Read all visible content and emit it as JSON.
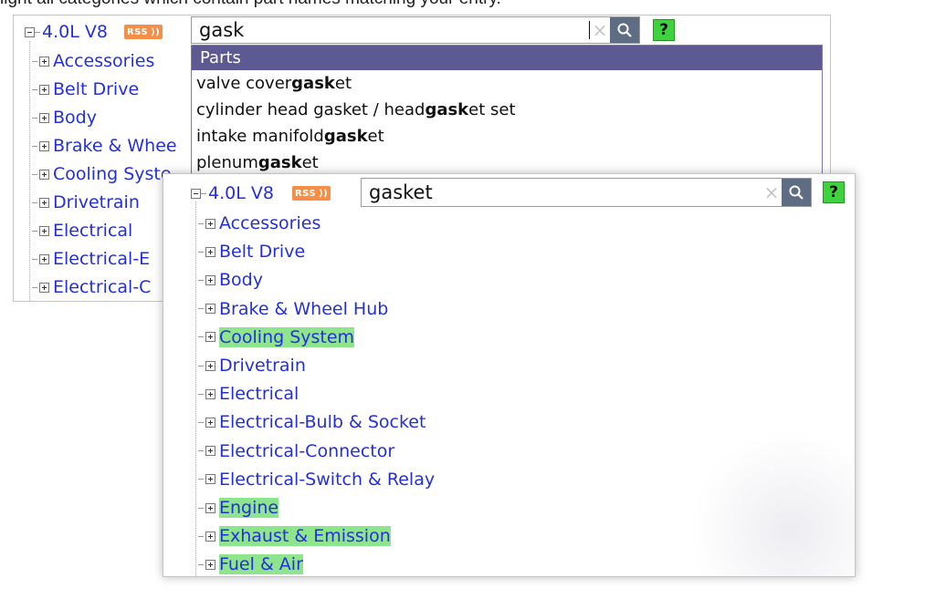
{
  "caption": "light all categories which contain part names matching your entry.",
  "brand_colors": {
    "link": "#2330d8",
    "highlight": "#8ee58e",
    "dropdown_header": "#5d5992",
    "search_button": "#5e6c84",
    "help_button": "#3ed23e",
    "rss": "#f58e46"
  },
  "panel_back": {
    "root_label": "4.0L V8",
    "rss_label": "RSS",
    "search_value": "gask",
    "clear_glyph": "×",
    "help_label": "?",
    "categories": [
      "Accessories",
      "Belt Drive",
      "Body",
      "Brake & Whee",
      "Cooling Syste",
      "Drivetrain",
      "Electrical",
      "Electrical-E",
      "Electrical-C"
    ],
    "dropdown": {
      "header": "Parts",
      "items": [
        {
          "pre": "valve cover ",
          "bold": "gask",
          "post": "et"
        },
        {
          "pre": "cylinder head gasket / head ",
          "bold": "gask",
          "post": "et set"
        },
        {
          "pre": "intake manifold ",
          "bold": "gask",
          "post": "et"
        },
        {
          "pre": "plenum ",
          "bold": "gask",
          "post": "et"
        }
      ]
    }
  },
  "panel_front": {
    "root_label": "4.0L V8",
    "rss_label": "RSS",
    "search_value": "gasket",
    "clear_glyph": "×",
    "help_label": "?",
    "categories": [
      {
        "label": "Accessories",
        "highlighted": false
      },
      {
        "label": "Belt Drive",
        "highlighted": false
      },
      {
        "label": "Body",
        "highlighted": false
      },
      {
        "label": "Brake & Wheel Hub",
        "highlighted": false
      },
      {
        "label": "Cooling System",
        "highlighted": true
      },
      {
        "label": "Drivetrain",
        "highlighted": false
      },
      {
        "label": "Electrical",
        "highlighted": false
      },
      {
        "label": "Electrical-Bulb & Socket",
        "highlighted": false
      },
      {
        "label": "Electrical-Connector",
        "highlighted": false
      },
      {
        "label": "Electrical-Switch & Relay",
        "highlighted": false
      },
      {
        "label": "Engine",
        "highlighted": true
      },
      {
        "label": "Exhaust & Emission",
        "highlighted": true
      },
      {
        "label": "Fuel & Air",
        "highlighted": true
      }
    ]
  }
}
